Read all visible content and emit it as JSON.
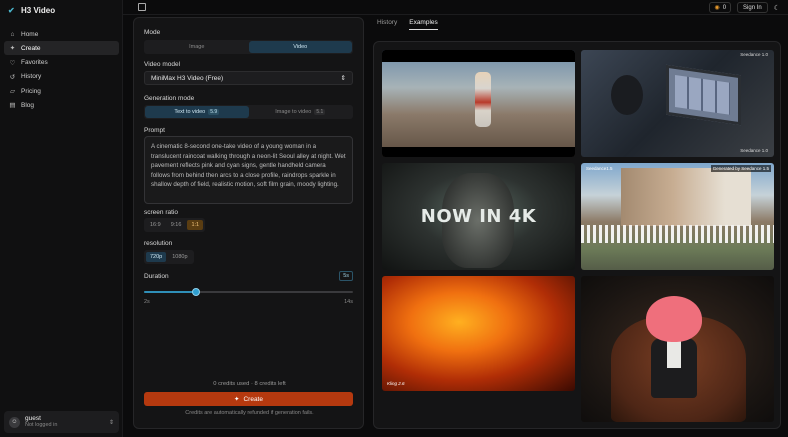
{
  "app": {
    "title": "H3 Video"
  },
  "sidebar": {
    "items": [
      {
        "label": "Home",
        "icon": "home-icon",
        "glyph": "⌂"
      },
      {
        "label": "Create",
        "icon": "sparkle-icon",
        "glyph": "✦"
      },
      {
        "label": "Favorites",
        "icon": "heart-icon",
        "glyph": "♡"
      },
      {
        "label": "History",
        "icon": "history-icon",
        "glyph": "↺"
      },
      {
        "label": "Pricing",
        "icon": "tag-icon",
        "glyph": "▱"
      },
      {
        "label": "Blog",
        "icon": "book-icon",
        "glyph": "▤"
      }
    ],
    "active_index": 1
  },
  "user": {
    "avatar_glyph": "☺",
    "name": "guest",
    "status": "Not logged in"
  },
  "topbar": {
    "credits": "0",
    "signin_label": "Sign In"
  },
  "form": {
    "mode_label": "Mode",
    "mode_options": [
      "Image",
      "Video"
    ],
    "mode_selected": "Video",
    "model_label": "Video model",
    "model_value": "MiniMax H3 Video (Free)",
    "gen_mode_label": "Generation mode",
    "gen_modes": [
      {
        "label": "Text to video",
        "badge": "5.9"
      },
      {
        "label": "Image to video",
        "badge": "5.1"
      }
    ],
    "prompt_label": "Prompt",
    "prompt_value": "A cinematic 8-second one-take video of a young woman in a translucent raincoat walking through a neon-lit Seoul alley at night. Wet pavement reflects pink and cyan signs, gentle handheld camera follows from behind then arcs to a close profile, raindrops sparkle in shallow depth of field, realistic motion, soft film grain, moody lighting.",
    "ratio_label": "screen ratio",
    "ratios": [
      "16:9",
      "9:16",
      "1:1"
    ],
    "ratio_selected": "1:1",
    "resolution_label": "resolution",
    "resolutions": [
      "720p",
      "1080p"
    ],
    "resolution_selected": "720p",
    "duration_label": "Duration",
    "duration_value": "5s",
    "duration_min": "2s",
    "duration_max": "14s",
    "duration_level": 0.25,
    "credits_info": "0 credits used · 8 credits left",
    "create_label": "Create",
    "refund_note": "Credits are automatically refunded if generation fails."
  },
  "tabs": {
    "items": [
      "History",
      "Examples"
    ],
    "active": "Examples"
  },
  "gallery": {
    "tile3_text": "NOW IN 4K",
    "tile2_watermark": "Seedance 1.0",
    "tile2_watermark2": "Seedance 1.0",
    "tile4_watermark": "Seedance1.5",
    "tile4_tag": "Generated by Seedance 1.5",
    "tile5_watermark": "Kling 2.6"
  }
}
